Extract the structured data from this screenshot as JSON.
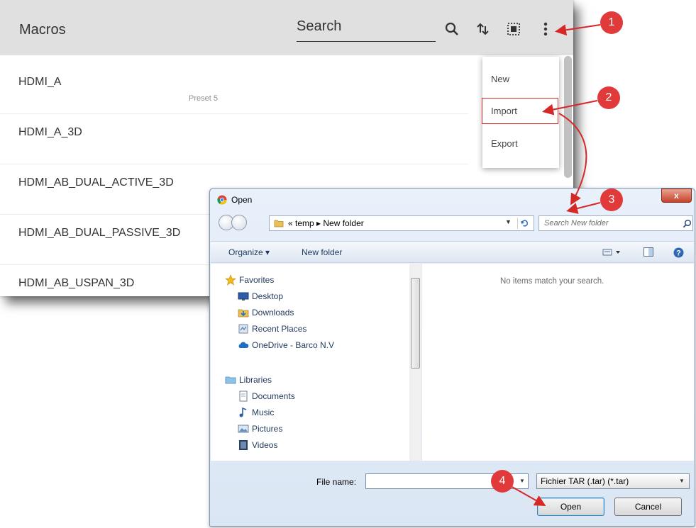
{
  "macros": {
    "title": "Macros",
    "search_label": "Search",
    "items": [
      {
        "name": "HDMI_A",
        "sub": "Preset 5"
      },
      {
        "name": "HDMI_A_3D",
        "sub": ""
      },
      {
        "name": "HDMI_AB_DUAL_ACTIVE_3D",
        "sub": ""
      },
      {
        "name": "HDMI_AB_DUAL_PASSIVE_3D",
        "sub": ""
      },
      {
        "name": "HDMI_AB_USPAN_3D",
        "sub": ""
      }
    ],
    "menu": {
      "new": "New",
      "import": "Import",
      "export": "Export"
    }
  },
  "dialog": {
    "title": "Open",
    "close": "x",
    "breadcrumb": "« temp ▸ New folder",
    "search_placeholder": "Search New folder",
    "toolbar": {
      "organize": "Organize ▾",
      "new_folder": "New folder"
    },
    "nav": {
      "favorites": "Favorites",
      "desktop": "Desktop",
      "downloads": "Downloads",
      "recent": "Recent Places",
      "onedrive": "OneDrive - Barco N.V",
      "libraries": "Libraries",
      "documents": "Documents",
      "music": "Music",
      "pictures": "Pictures",
      "videos": "Videos"
    },
    "empty_message": "No items match your search.",
    "filename_label": "File name:",
    "filename_value": "",
    "filetype": "Fichier TAR (.tar) (*.tar)",
    "open": "Open",
    "cancel": "Cancel"
  },
  "callouts": [
    "1",
    "2",
    "3",
    "4"
  ],
  "colors": {
    "callout": "#e03a3a",
    "header": "#e0e0e0",
    "dialog_chrome": "#dbe6f4"
  },
  "icons": [
    "search-icon",
    "sort-icon",
    "select-all-icon",
    "more-vert-icon",
    "chrome-icon",
    "folder-icon",
    "star-icon",
    "desktop-icon",
    "downloads-icon",
    "recent-places-icon",
    "onedrive-icon",
    "libraries-icon",
    "documents-icon",
    "music-icon",
    "pictures-icon",
    "videos-icon",
    "help-icon"
  ]
}
